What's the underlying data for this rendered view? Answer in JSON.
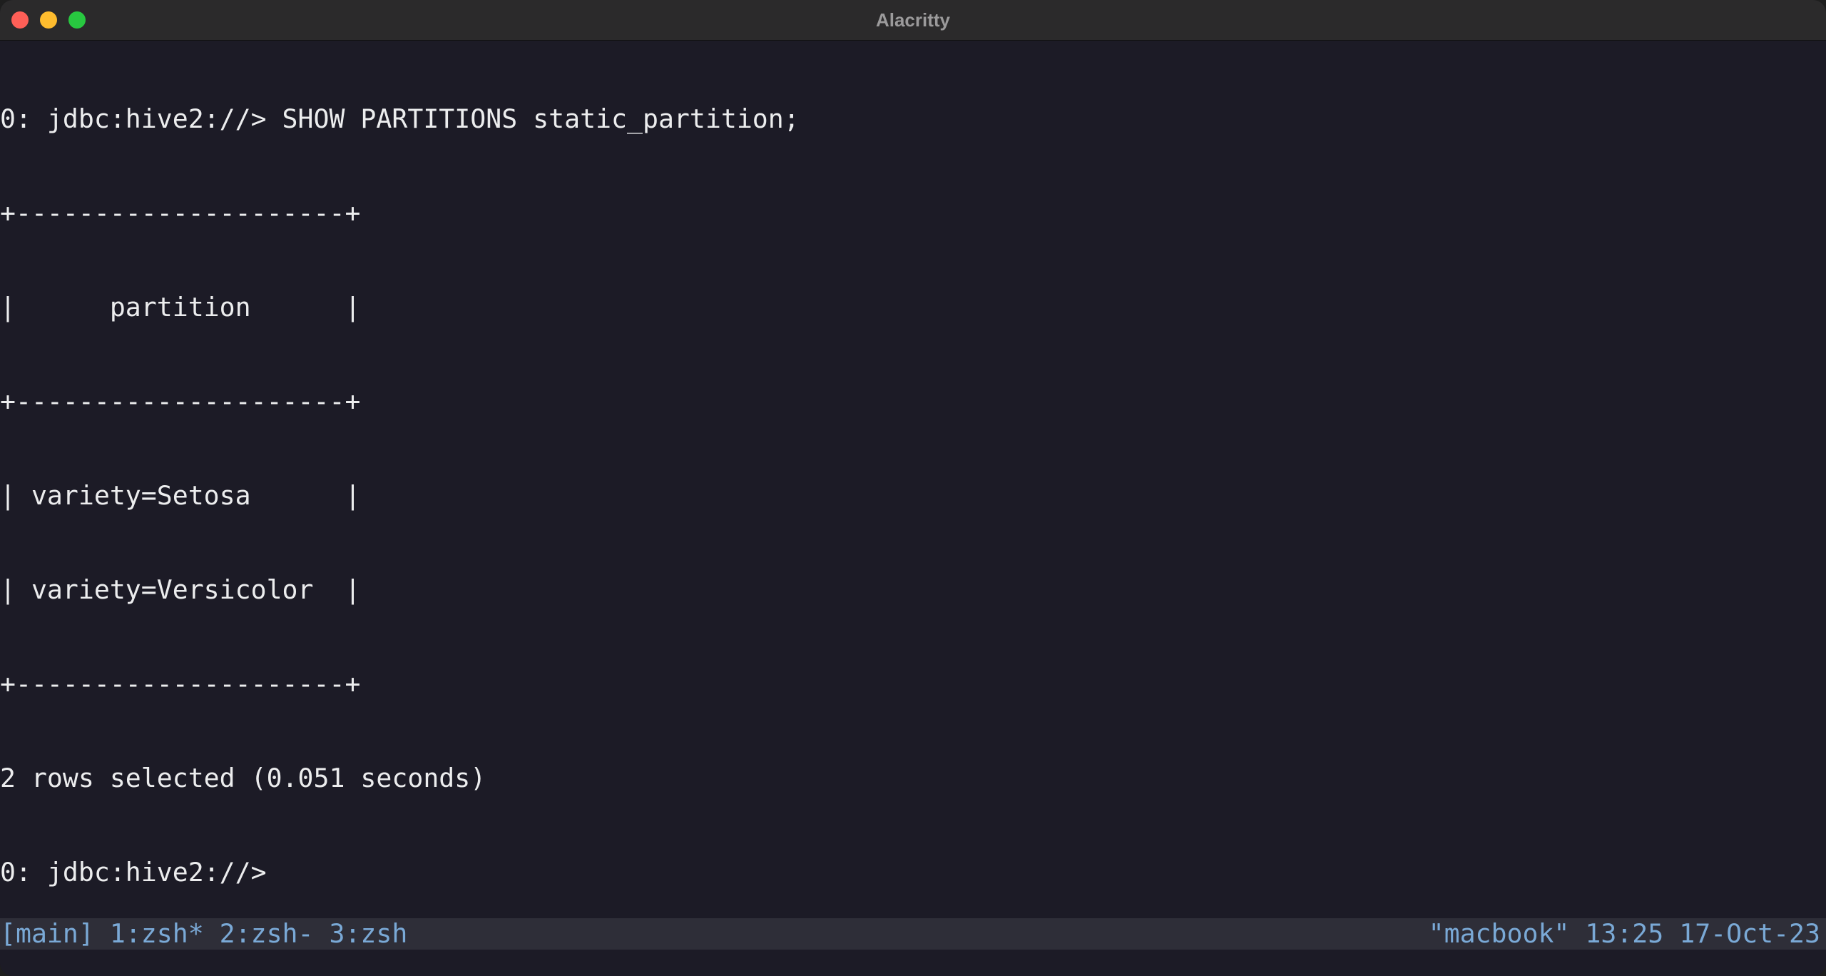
{
  "window": {
    "title": "Alacritty"
  },
  "terminal": {
    "lines": [
      "0: jdbc:hive2://> SHOW PARTITIONS static_partition;",
      "+---------------------+",
      "|      partition      |",
      "+---------------------+",
      "| variety=Setosa      |",
      "| variety=Versicolor  |",
      "+---------------------+",
      "2 rows selected (0.051 seconds)",
      "0: jdbc:hive2://> "
    ]
  },
  "statusbar": {
    "left": "[main] 1:zsh* 2:zsh- 3:zsh",
    "right": "\"macbook\" 13:25 17-Oct-23"
  },
  "colors": {
    "background": "#1c1b26",
    "text": "#ecedee",
    "statusbar_bg": "#2e2e38",
    "statusbar_text": "#7aa9d6"
  }
}
